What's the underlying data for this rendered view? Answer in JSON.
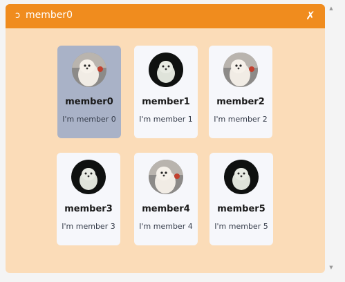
{
  "window": {
    "title_icon": "refresh-icon",
    "title_icon_glyph": "ↄ",
    "title": "member0",
    "close_glyph": "✗",
    "colors": {
      "titlebar": "#f08c1e",
      "panel": "#fbdcb8",
      "card": "#f6f7fb",
      "card_selected": "#a9b2c7"
    }
  },
  "members": [
    {
      "name": "member0",
      "desc": "I'm member 0",
      "avatar": "fluffy-dog-light",
      "selected": true
    },
    {
      "name": "member1",
      "desc": "I'm member 1",
      "avatar": "fluffy-dog-dark",
      "selected": false
    },
    {
      "name": "member2",
      "desc": "I'm member 2",
      "avatar": "fluffy-dog-light",
      "selected": false
    },
    {
      "name": "member3",
      "desc": "I'm member 3",
      "avatar": "fluffy-dog-dark",
      "selected": false
    },
    {
      "name": "member4",
      "desc": "I'm member 4",
      "avatar": "fluffy-dog-light",
      "selected": false
    },
    {
      "name": "member5",
      "desc": "I'm member 5",
      "avatar": "fluffy-dog-dark",
      "selected": false
    }
  ],
  "scrollbar": {
    "up_glyph": "▲",
    "down_glyph": "▼"
  }
}
